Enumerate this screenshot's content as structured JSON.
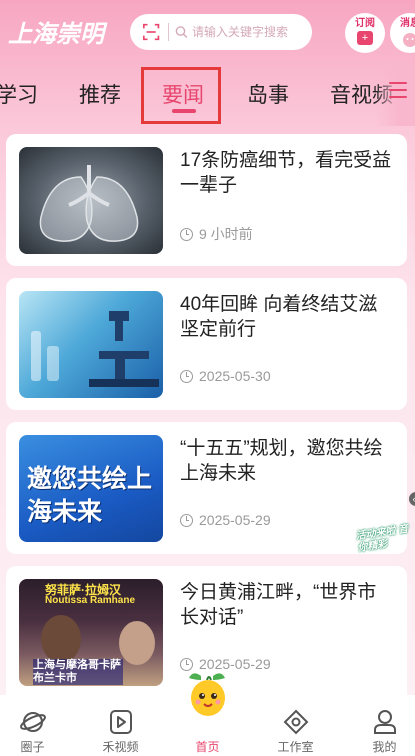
{
  "header": {
    "logo_text": "上海崇明",
    "search_placeholder": "请输入关键字搜索",
    "subscribe_label": "订阅",
    "subscribe_badge": "+",
    "message_label": "消息"
  },
  "tabs": [
    {
      "label": "学习"
    },
    {
      "label": "推荐"
    },
    {
      "label": "要闻"
    },
    {
      "label": "岛事"
    },
    {
      "label": "音视频"
    }
  ],
  "active_tab": "要闻",
  "news": [
    {
      "title": "17条防癌细节，看完受益一辈子",
      "time": "9 小时前",
      "image": "lung-xray"
    },
    {
      "title": "40年回眸 向着终结艾滋坚定前行",
      "time": "2025-05-30",
      "image": "lab-microscope"
    },
    {
      "title": "“十五五”规划，邀您共绘上海未来",
      "time": "2025-05-29",
      "image": "invite-banner",
      "image_text": "邀您共绘上海未来"
    },
    {
      "title": "今日黄浦江畔，“世界市长对话”",
      "time": "2025-05-29",
      "image": "city-dialogue",
      "image_text_top": "努菲萨·拉姆汉",
      "image_text_en": "Noutissa Ramhane",
      "image_text_bottom": "上海与摩洛哥卡萨布兰卡市"
    }
  ],
  "float_tag": "活动来啦 音你精彩",
  "bottom_nav": [
    {
      "label": "圈子",
      "icon": "planet-icon"
    },
    {
      "label": "禾视频",
      "icon": "video-icon"
    },
    {
      "label": "首页",
      "icon": "home-mascot-icon"
    },
    {
      "label": "工作室",
      "icon": "studio-icon"
    },
    {
      "label": "我的",
      "icon": "user-icon"
    }
  ],
  "colors": {
    "accent": "#e8466e",
    "highlight_box": "#e43a3a"
  }
}
